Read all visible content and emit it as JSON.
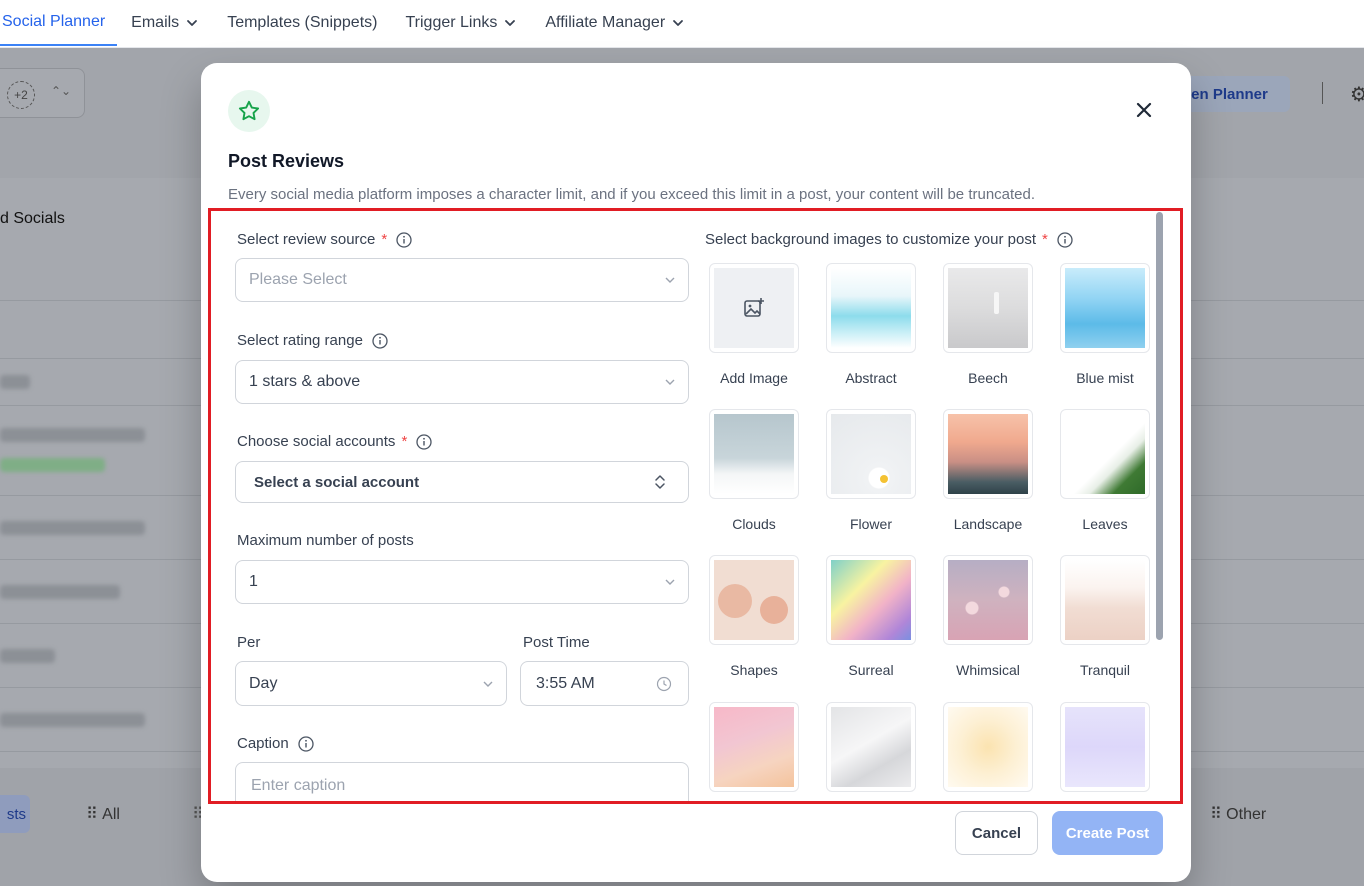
{
  "topnav": {
    "tabs": [
      {
        "label": "Social Planner",
        "active": true,
        "has_dropdown": false
      },
      {
        "label": "Emails",
        "active": false,
        "has_dropdown": true
      },
      {
        "label": "Templates (Snippets)",
        "active": false,
        "has_dropdown": false
      },
      {
        "label": "Trigger Links",
        "active": false,
        "has_dropdown": true
      },
      {
        "label": "Affiliate Manager",
        "active": false,
        "has_dropdown": true
      }
    ]
  },
  "background": {
    "account_badge": "+2",
    "open_planner": "pen Planner",
    "socials_title": "d Socials",
    "bottom_tabs": {
      "active": "sts",
      "all": "All",
      "other": "Other"
    }
  },
  "modal": {
    "icon": "star-icon",
    "title": "Post Reviews",
    "subtitle": "Every social media platform imposes a character limit, and if you exceed this limit in a post, your content will be truncated.",
    "review_source": {
      "label": "Select review source",
      "placeholder": "Please Select",
      "required": true
    },
    "rating_range": {
      "label": "Select rating range",
      "value": "1 stars & above"
    },
    "social_accounts": {
      "label": "Choose social accounts",
      "placeholder": "Select a social account",
      "required": true
    },
    "max_posts": {
      "label": "Maximum number of posts",
      "value": "1"
    },
    "per": {
      "label": "Per",
      "value": "Day"
    },
    "post_time": {
      "label": "Post Time",
      "value": "3:55 AM"
    },
    "caption": {
      "label": "Caption",
      "placeholder": "Enter caption"
    },
    "backgrounds": {
      "label": "Select background images to customize your post",
      "required": true,
      "items": [
        {
          "name": "Add Image"
        },
        {
          "name": "Abstract"
        },
        {
          "name": "Beech"
        },
        {
          "name": "Blue mist"
        },
        {
          "name": "Clouds"
        },
        {
          "name": "Flower"
        },
        {
          "name": "Landscape"
        },
        {
          "name": "Leaves"
        },
        {
          "name": "Shapes"
        },
        {
          "name": "Surreal"
        },
        {
          "name": "Whimsical"
        },
        {
          "name": "Tranquil"
        },
        {
          "name": ""
        },
        {
          "name": ""
        },
        {
          "name": ""
        },
        {
          "name": ""
        }
      ]
    },
    "buttons": {
      "cancel": "Cancel",
      "create": "Create Post"
    }
  },
  "colors": {
    "accent": "#3b82f6",
    "create_button": "#93b4f5",
    "highlight_border": "#e11d24",
    "star_green": "#16a34a"
  }
}
